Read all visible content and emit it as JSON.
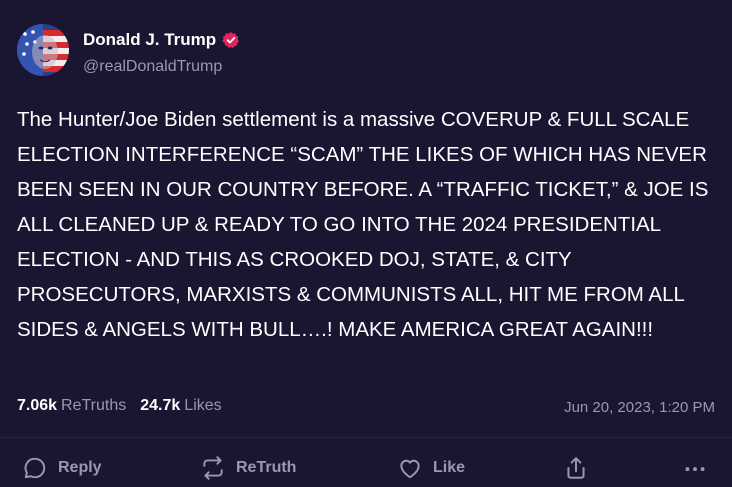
{
  "author": {
    "name": "Donald J. Trump",
    "handle": "@realDonaldTrump",
    "verified_icon": "verified-badge-icon",
    "verified_color": "#e0245e"
  },
  "post": {
    "text": "The Hunter/Joe Biden settlement is a massive COVERUP & FULL SCALE ELECTION INTERFERENCE “SCAM” THE LIKES OF WHICH HAS NEVER BEEN SEEN IN OUR COUNTRY BEFORE. A “TRAFFIC TICKET,” & JOE IS ALL CLEANED UP & READY TO GO INTO THE 2024 PRESIDENTIAL ELECTION - AND THIS AS CROOKED DOJ, STATE, & CITY PROSECUTORS, MARXISTS & COMMUNISTS ALL, HIT ME FROM ALL SIDES & ANGELS WITH BULL….! MAKE AMERICA GREAT AGAIN!!!"
  },
  "stats": {
    "retruths_count": "7.06k",
    "retruths_label": "ReTruths",
    "likes_count": "24.7k",
    "likes_label": "Likes"
  },
  "timestamp": "Jun 20, 2023, 1:20 PM",
  "actions": {
    "reply": {
      "label": "Reply",
      "icon": "reply-icon"
    },
    "retruth": {
      "label": "ReTruth",
      "icon": "retruth-icon"
    },
    "like": {
      "label": "Like",
      "icon": "heart-icon"
    },
    "share": {
      "icon": "share-icon"
    },
    "more": {
      "icon": "more-icon"
    }
  },
  "colors": {
    "background": "#1a1530",
    "text": "#ffffff",
    "muted": "#9c97b0"
  }
}
